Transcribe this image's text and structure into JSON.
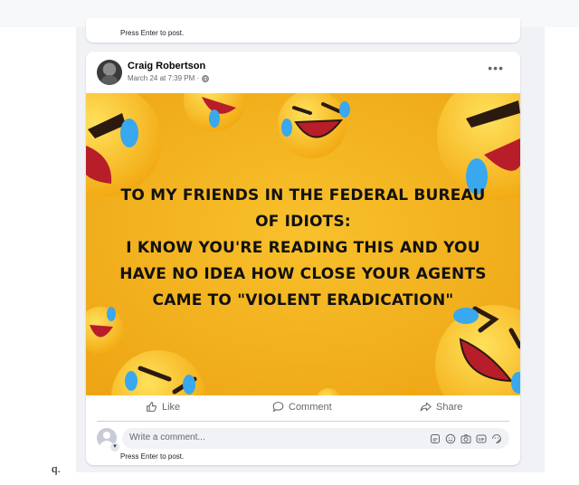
{
  "prev_post": {
    "hint": "Press Enter to post."
  },
  "post": {
    "author": "Craig Robertson",
    "timestamp": "March 24 at 7:39 PM ·",
    "more_label": "•••",
    "image_text_lines": [
      "TO MY FRIENDS IN THE FEDERAL BUREAU",
      "OF IDIOTS:",
      "I KNOW YOU'RE READING THIS AND YOU",
      "HAVE NO IDEA HOW CLOSE YOUR AGENTS",
      "CAME TO \"VIOLENT ERADICATION\""
    ],
    "image_emoji": "laughing-crying-emoji-background"
  },
  "actions": {
    "like": "Like",
    "comment": "Comment",
    "share": "Share"
  },
  "comment": {
    "placeholder": "Write a comment...",
    "hint": "Press Enter to post.",
    "icons": [
      "gif-sticker-icon",
      "emoji-icon",
      "camera-icon",
      "gif-icon",
      "sticker-icon"
    ]
  },
  "stray_text": "q.",
  "colors": {
    "image_bg": "#f5b51a",
    "text": "#050505",
    "muted": "#65676b",
    "feed_bg": "#f0f2f5"
  }
}
